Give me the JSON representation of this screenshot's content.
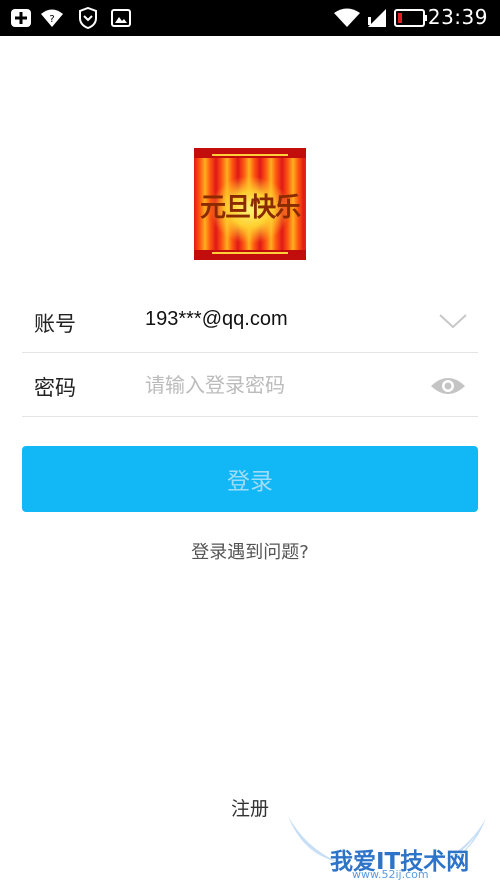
{
  "status_bar": {
    "time": "23:39",
    "icons": [
      "add-icon",
      "wifi-question-icon",
      "shield-icon",
      "image-icon",
      "wifi-icon",
      "signal-icon",
      "battery-low-icon"
    ]
  },
  "avatar": {
    "text": "元旦快乐"
  },
  "account": {
    "label": "账号",
    "value": "193***@qq.com"
  },
  "password": {
    "label": "密码",
    "placeholder": "请输入登录密码",
    "value": ""
  },
  "login_button": "登录",
  "problem_link": "登录遇到问题?",
  "register_link": "注册",
  "watermark": {
    "text": "我爱IT技术网",
    "url": "www.52ij.com"
  },
  "colors": {
    "primary": "#12b7f5",
    "button_text": "#9fdcf6",
    "divider": "#e4e4e4",
    "battery_low": "#e02020"
  }
}
